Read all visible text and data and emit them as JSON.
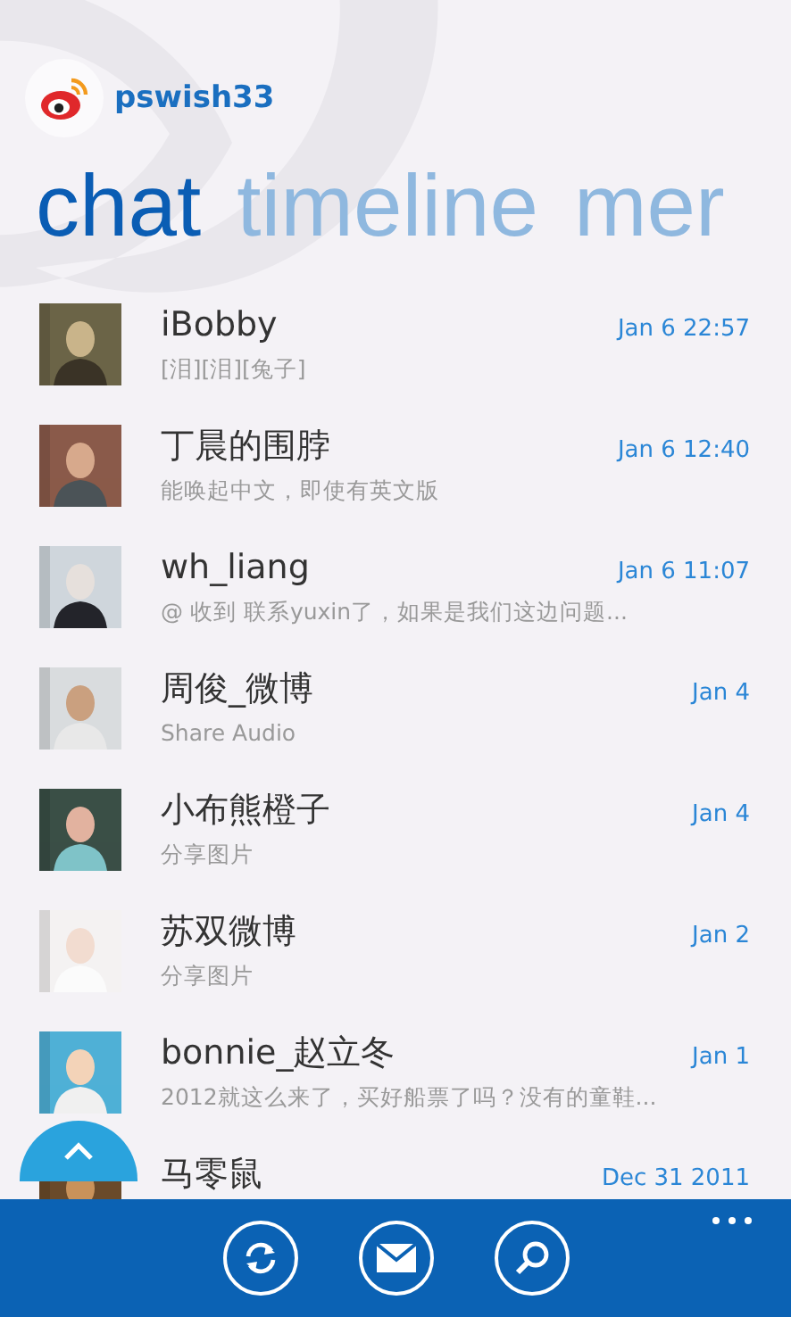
{
  "header": {
    "username": "pswish33"
  },
  "pivots": [
    {
      "label": "chat",
      "selected": true
    },
    {
      "label": "timeline",
      "selected": false
    },
    {
      "label": "mer",
      "selected": false
    }
  ],
  "conversations": [
    {
      "name": "iBobby",
      "preview": "[泪][泪][兔子]",
      "date": "Jan 6 22:57"
    },
    {
      "name": "丁晨的围脖",
      "preview": "能唤起中文，即使有英文版",
      "date": "Jan 6 12:40"
    },
    {
      "name": "wh_liang",
      "preview": "@ 收到  联系yuxin了，如果是我们这边问题...",
      "date": "Jan 6 11:07"
    },
    {
      "name": "周俊_微博",
      "preview": "Share Audio",
      "date": "Jan 4"
    },
    {
      "name": "小布熊橙子",
      "preview": "分享图片",
      "date": "Jan 4"
    },
    {
      "name": "苏双微博",
      "preview": "分享图片",
      "date": "Jan 2"
    },
    {
      "name": "bonnie_赵立冬",
      "preview": "2012就这么来了，买好船票了吗？没有的童鞋...",
      "date": "Jan 1"
    },
    {
      "name": "马零鼠",
      "date": "Dec 31 2011"
    }
  ],
  "app_bar": {
    "buttons": [
      {
        "kind": "refresh"
      },
      {
        "kind": "compose"
      },
      {
        "kind": "search"
      }
    ],
    "more": true
  },
  "scroll_top": true
}
